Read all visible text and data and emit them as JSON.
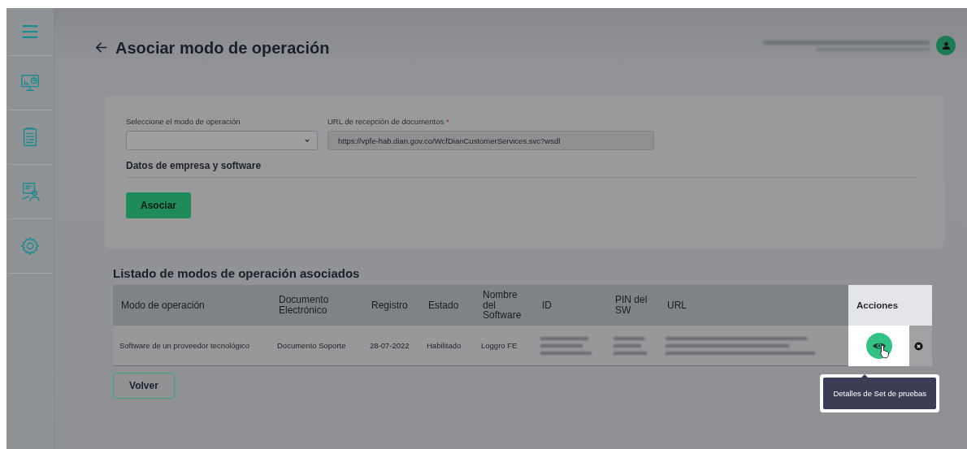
{
  "sidebar": {
    "items": [
      {
        "kind": "dashboard"
      },
      {
        "kind": "document"
      },
      {
        "kind": "person"
      },
      {
        "kind": "settings"
      }
    ]
  },
  "header": {
    "title": "Asociar modo de operación"
  },
  "form": {
    "select": {
      "label": "Seleccione el modo de operación"
    },
    "url": {
      "label": "URL de recepción de documentos",
      "required_mark": "*",
      "value": "https://vpfe-hab.dian.gov.co/WcfDianCustomerServices.svc?wsdl"
    },
    "section": "Datos de empresa y software",
    "button": "Asociar"
  },
  "table": {
    "title": "Listado de modos de operación asociados",
    "columns": [
      "Modo de operación",
      "Documento Electrónico",
      "Registro",
      "Estado",
      "Nombre del Software",
      "ID",
      "PIN del SW",
      "URL",
      "Acciones"
    ],
    "rows": [
      {
        "cells": [
          {
            "kind": "text",
            "text": "Software de un proveedor tecnológico"
          },
          {
            "kind": "text",
            "text": "Documento Soporte"
          },
          {
            "kind": "text",
            "text": "28-07-2022"
          },
          {
            "kind": "text",
            "text": "Habilitado"
          },
          {
            "kind": "text",
            "text": "Loggro FE"
          },
          {
            "kind": "blurred"
          },
          {
            "kind": "blurred"
          },
          {
            "kind": "blurred"
          },
          {
            "kind": "actions",
            "actions": [
              {
                "kind": "view",
                "hovered": true,
                "tooltip": "Detalles de Set de pruebas"
              },
              {
                "kind": "delete"
              }
            ]
          }
        ]
      }
    ]
  },
  "back_button": "Volver"
}
